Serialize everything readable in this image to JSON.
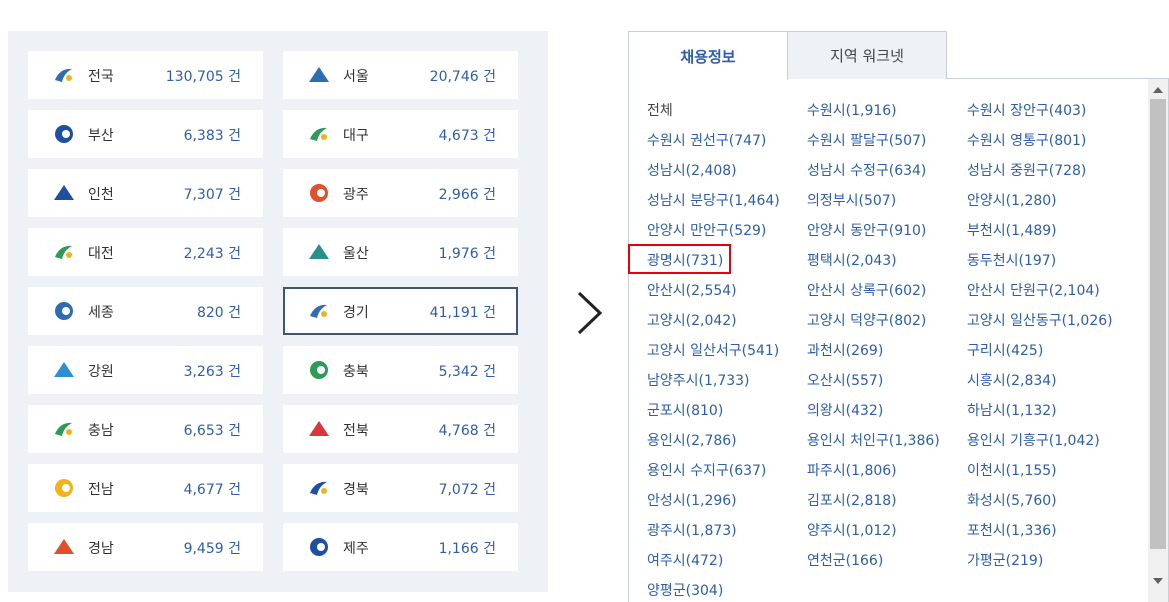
{
  "regions": [
    {
      "name": "전국",
      "count": "130,705 건",
      "icon": "nation-emblem-icon",
      "color": "#2e6db4"
    },
    {
      "name": "서울",
      "count": "20,746 건",
      "icon": "seoul-emblem-icon",
      "color": "#2e6db4"
    },
    {
      "name": "부산",
      "count": "6,383 건",
      "icon": "busan-emblem-icon",
      "color": "#1f4fa0"
    },
    {
      "name": "대구",
      "count": "4,673 건",
      "icon": "daegu-emblem-icon",
      "color": "#2d9b57"
    },
    {
      "name": "인천",
      "count": "7,307 건",
      "icon": "incheon-emblem-icon",
      "color": "#1f4fa0"
    },
    {
      "name": "광주",
      "count": "2,966 건",
      "icon": "gwangju-emblem-icon",
      "color": "#e0502d"
    },
    {
      "name": "대전",
      "count": "2,243 건",
      "icon": "daejeon-emblem-icon",
      "color": "#2d9b57"
    },
    {
      "name": "울산",
      "count": "1,976 건",
      "icon": "ulsan-emblem-icon",
      "color": "#2a8f8a"
    },
    {
      "name": "세종",
      "count": "820 건",
      "icon": "sejong-emblem-icon",
      "color": "#2e6db4"
    },
    {
      "name": "경기",
      "count": "41,191 건",
      "icon": "gyeonggi-emblem-icon",
      "color": "#2e6db4",
      "selected": true
    },
    {
      "name": "강원",
      "count": "3,263 건",
      "icon": "gangwon-emblem-icon",
      "color": "#2e8fd0"
    },
    {
      "name": "충북",
      "count": "5,342 건",
      "icon": "chungbuk-emblem-icon",
      "color": "#2d9b57"
    },
    {
      "name": "충남",
      "count": "6,653 건",
      "icon": "chungnam-emblem-icon",
      "color": "#2d9b57"
    },
    {
      "name": "전북",
      "count": "4,768 건",
      "icon": "jeonbuk-emblem-icon",
      "color": "#d9363e"
    },
    {
      "name": "전남",
      "count": "4,677 건",
      "icon": "jeonnam-emblem-icon",
      "color": "#f2b21c"
    },
    {
      "name": "경북",
      "count": "7,072 건",
      "icon": "gyeongbuk-emblem-icon",
      "color": "#1f4fa0"
    },
    {
      "name": "경남",
      "count": "9,459 건",
      "icon": "gyeongnam-emblem-icon",
      "color": "#e0502d"
    },
    {
      "name": "제주",
      "count": "1,166 건",
      "icon": "jeju-emblem-icon",
      "color": "#1f4fa0"
    }
  ],
  "tabs": [
    {
      "label": "채용정보",
      "active": true
    },
    {
      "label": "지역 워크넷",
      "active": false
    }
  ],
  "districts": [
    "전체",
    "수원시(1,916)",
    "수원시 장안구(403)",
    "수원시 권선구(747)",
    "수원시 팔달구(507)",
    "수원시 영통구(801)",
    "성남시(2,408)",
    "성남시 수정구(634)",
    "성남시 중원구(728)",
    "성남시 분당구(1,464)",
    "의정부시(507)",
    "안양시(1,280)",
    "안양시 만안구(529)",
    "안양시 동안구(910)",
    "부천시(1,489)",
    "광명시(731)",
    "평택시(2,043)",
    "동두천시(197)",
    "안산시(2,554)",
    "안산시 상록구(602)",
    "안산시 단원구(2,104)",
    "고양시(2,042)",
    "고양시 덕양구(802)",
    "고양시 일산동구(1,026)",
    "고양시 일산서구(541)",
    "과천시(269)",
    "구리시(425)",
    "남양주시(1,733)",
    "오산시(557)",
    "시흥시(2,834)",
    "군포시(810)",
    "의왕시(432)",
    "하남시(1,132)",
    "용인시(2,786)",
    "용인시 처인구(1,386)",
    "용인시 기흥구(1,042)",
    "용인시 수지구(637)",
    "파주시(1,806)",
    "이천시(1,155)",
    "안성시(1,296)",
    "김포시(2,818)",
    "화성시(5,760)",
    "광주시(1,873)",
    "양주시(1,012)",
    "포천시(1,336)",
    "여주시(472)",
    "연천군(166)",
    "가평군(219)",
    "양평군(304)"
  ],
  "highlighted_district": "광명시(731)",
  "colors": {
    "accent_blue": "#2e5ea8",
    "highlight_red": "#e60012",
    "panel_bg": "#eef2f7"
  }
}
